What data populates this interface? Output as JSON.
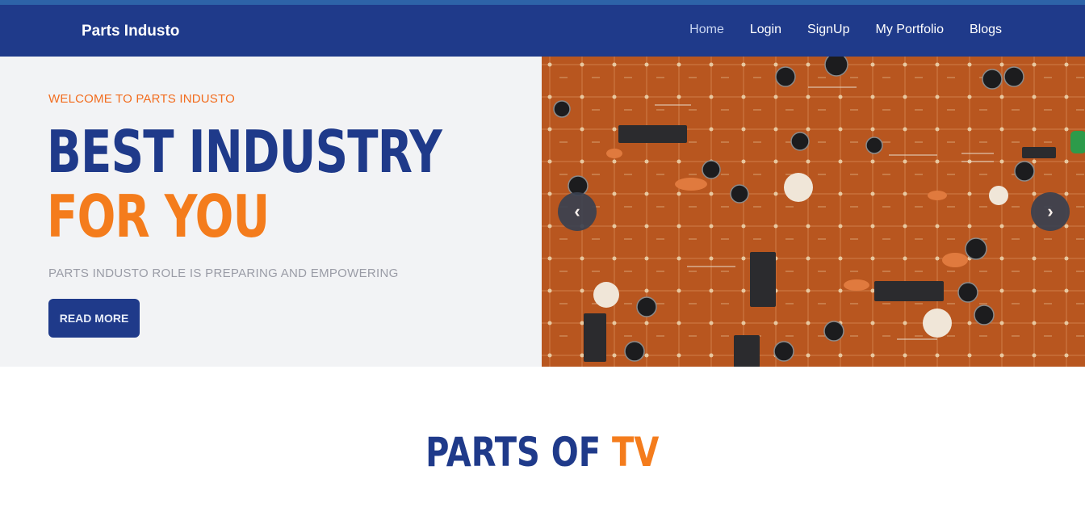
{
  "navbar": {
    "brand": "Parts Industo",
    "links": [
      "Home",
      "Login",
      "SignUp",
      "My Portfolio",
      "Blogs"
    ],
    "active_link": "Home"
  },
  "hero": {
    "welcome": "WELCOME TO PARTS INDUSTO",
    "headline_line1": "BEST INDUSTRY",
    "headline_line2": "FOR YOU",
    "subtitle": "PARTS INDUSTO ROLE IS PREPARING AND EMPOWERING",
    "button_label": "READ MORE",
    "carousel": {
      "prev_icon": "‹",
      "next_icon": "›",
      "image": "circuit-board-photo"
    }
  },
  "section": {
    "title_part1": "PARTS OF",
    "title_part2": "TV"
  },
  "colors": {
    "primary": "#1f3a8a",
    "accent": "#f47c1c",
    "hero_bg": "#f2f3f5",
    "muted_text": "#9a9ca6"
  }
}
